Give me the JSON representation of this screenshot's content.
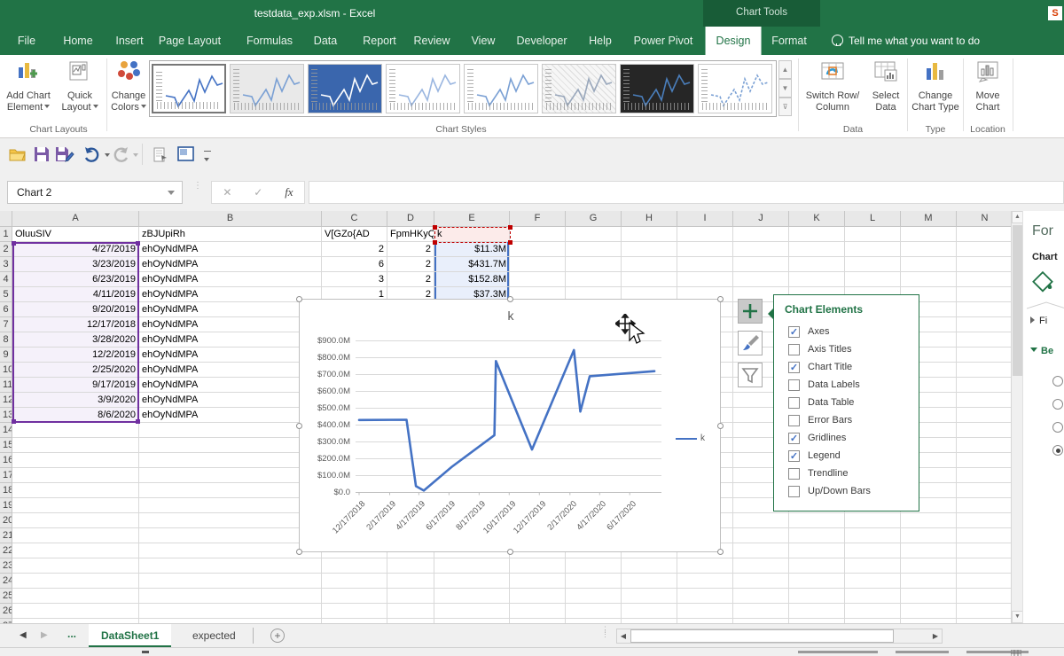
{
  "title_bar": {
    "title": "testdata_exp.xlsm - Excel",
    "contextual_label": "Chart Tools",
    "corner_badge": "S"
  },
  "ribbon_tabs": {
    "items": [
      "File",
      "Home",
      "Insert",
      "Page Layout",
      "Formulas",
      "Data",
      "Report",
      "Review",
      "View",
      "Developer",
      "Help",
      "Power Pivot",
      "Design",
      "Format"
    ],
    "active": "Design",
    "tell_me": "Tell me what you want to do"
  },
  "ribbon": {
    "add_chart_element": {
      "line1": "Add Chart",
      "line2": "Element"
    },
    "quick_layout": {
      "line1": "Quick",
      "line2": "Layout"
    },
    "change_colors": {
      "line1": "Change",
      "line2": "Colors"
    },
    "switch_row_column": {
      "line1": "Switch Row/",
      "line2": "Column"
    },
    "select_data": {
      "line1": "Select",
      "line2": "Data"
    },
    "change_chart_type": {
      "line1": "Change",
      "line2": "Chart Type"
    },
    "move_chart": {
      "line1": "Move",
      "line2": "Chart"
    },
    "groups": {
      "chart_layouts": "Chart Layouts",
      "chart_styles": "Chart Styles",
      "data": "Data",
      "type": "Type",
      "location": "Location"
    }
  },
  "formula_bar": {
    "name_box": "Chart 2",
    "cancel_icon": "✕",
    "enter_icon": "✓",
    "fx_label": "fx",
    "value": ""
  },
  "sheet": {
    "col_headers": [
      "A",
      "B",
      "C",
      "D",
      "E",
      "F",
      "G",
      "H",
      "I",
      "J",
      "K",
      "L",
      "M",
      "N"
    ],
    "row_count": 27,
    "header_row": {
      "a": "OluuSIV",
      "b": "zBJUpiRh",
      "c": "V[GZo{AD",
      "d": "FpmHKyQ",
      "e": "k"
    },
    "rows": [
      {
        "a": "4/27/2019",
        "b": "ehOyNdMPA",
        "c": "2",
        "d": "2",
        "e": "$11.3M"
      },
      {
        "a": "3/23/2019",
        "b": "ehOyNdMPA",
        "c": "6",
        "d": "2",
        "e": "$431.7M"
      },
      {
        "a": "6/23/2019",
        "b": "ehOyNdMPA",
        "c": "3",
        "d": "2",
        "e": "$152.8M"
      },
      {
        "a": "4/11/2019",
        "b": "ehOyNdMPA",
        "c": "1",
        "d": "2",
        "e": "$37.3M"
      },
      {
        "a": "9/20/2019",
        "b": "ehOyNdMPA"
      },
      {
        "a": "12/17/2018",
        "b": "ehOyNdMPA"
      },
      {
        "a": "3/28/2020",
        "b": "ehOyNdMPA"
      },
      {
        "a": "12/2/2019",
        "b": "ehOyNdMPA"
      },
      {
        "a": "2/25/2020",
        "b": "ehOyNdMPA"
      },
      {
        "a": "9/17/2019",
        "b": "ehOyNdMPA"
      },
      {
        "a": "3/9/2020",
        "b": "ehOyNdMPA"
      },
      {
        "a": "8/6/2020",
        "b": "ehOyNdMPA"
      }
    ]
  },
  "chart_data": {
    "type": "line",
    "title": "k",
    "legend": [
      "k"
    ],
    "legend_position": "right",
    "gridlines": true,
    "ylim": [
      0,
      900
    ],
    "unit": "millions USD",
    "line_color": "#4472C4",
    "y_ticks": [
      "$900.0M",
      "$800.0M",
      "$700.0M",
      "$600.0M",
      "$500.0M",
      "$400.0M",
      "$300.0M",
      "$200.0M",
      "$100.0M",
      "$0.0"
    ],
    "x_ticks": [
      "12/17/2018",
      "2/17/2019",
      "4/17/2019",
      "6/17/2019",
      "8/17/2019",
      "10/17/2019",
      "12/17/2019",
      "2/17/2020",
      "4/17/2020",
      "6/17/2020"
    ],
    "series": [
      {
        "name": "k",
        "points": [
          {
            "x": "12/17/2018",
            "y": 430
          },
          {
            "x": "3/23/2019",
            "y": 431.7
          },
          {
            "x": "4/11/2019",
            "y": 37.3
          },
          {
            "x": "4/27/2019",
            "y": 11.3
          },
          {
            "x": "6/23/2019",
            "y": 152.8
          },
          {
            "x": "9/17/2019",
            "y": 340
          },
          {
            "x": "9/20/2019",
            "y": 780
          },
          {
            "x": "12/2/2019",
            "y": 255
          },
          {
            "x": "2/25/2020",
            "y": 845
          },
          {
            "x": "3/9/2020",
            "y": 480
          },
          {
            "x": "3/28/2020",
            "y": 690
          },
          {
            "x": "8/6/2020",
            "y": 720
          }
        ]
      }
    ]
  },
  "chart_elements_popup": {
    "title": "Chart Elements",
    "items": [
      {
        "label": "Axes",
        "checked": true
      },
      {
        "label": "Axis Titles",
        "checked": false
      },
      {
        "label": "Chart Title",
        "checked": true
      },
      {
        "label": "Data Labels",
        "checked": false
      },
      {
        "label": "Data Table",
        "checked": false
      },
      {
        "label": "Error Bars",
        "checked": false
      },
      {
        "label": "Gridlines",
        "checked": true
      },
      {
        "label": "Legend",
        "checked": true
      },
      {
        "label": "Trendline",
        "checked": false
      },
      {
        "label": "Up/Down Bars",
        "checked": false
      }
    ]
  },
  "format_pane": {
    "title": "For",
    "subtitle": "Chart",
    "fill_section": "Fi",
    "border_section": "Be",
    "radio_count": 4,
    "radio_selected_index": 3
  },
  "sheet_tabs": {
    "ellipsis": "...",
    "tabs": [
      {
        "label": "DataSheet1",
        "active": true
      },
      {
        "label": "expected",
        "active": false
      }
    ]
  },
  "colors": {
    "excel_green": "#217346",
    "contextual_green": "#185C37",
    "accent_blue": "#4472C4",
    "marquee_red": "#C00000",
    "range_purple": "#7030A0"
  }
}
